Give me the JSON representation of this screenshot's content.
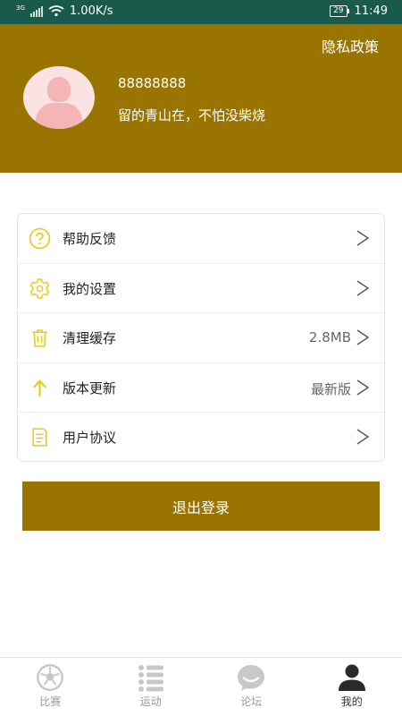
{
  "status_bar": {
    "network": "3G",
    "speed": "1.00K/s",
    "battery": "29",
    "time": "11:49"
  },
  "header": {
    "privacy_link": "隐私政策",
    "user_id": "88888888",
    "motto": "留的青山在，不怕没柴烧"
  },
  "menu": {
    "items": [
      {
        "label": "帮助反馈",
        "icon": "help-icon",
        "value": ""
      },
      {
        "label": "我的设置",
        "icon": "gear-icon",
        "value": ""
      },
      {
        "label": "清理缓存",
        "icon": "trash-icon",
        "value": "2.8MB"
      },
      {
        "label": "版本更新",
        "icon": "arrow-up-icon",
        "value": "最新版"
      },
      {
        "label": "用户协议",
        "icon": "document-icon",
        "value": ""
      }
    ]
  },
  "logout_label": "退出登录",
  "tabbar": {
    "active_index": 3,
    "tabs": [
      {
        "label": "比赛",
        "icon": "soccer-ball-icon"
      },
      {
        "label": "运动",
        "icon": "list-icon"
      },
      {
        "label": "论坛",
        "icon": "chat-bubble-icon"
      },
      {
        "label": "我的",
        "icon": "person-icon"
      }
    ]
  },
  "colors": {
    "status_bar": "#1a5a4a",
    "brand": "#9a7400",
    "icon_accent": "#f0c81a"
  }
}
